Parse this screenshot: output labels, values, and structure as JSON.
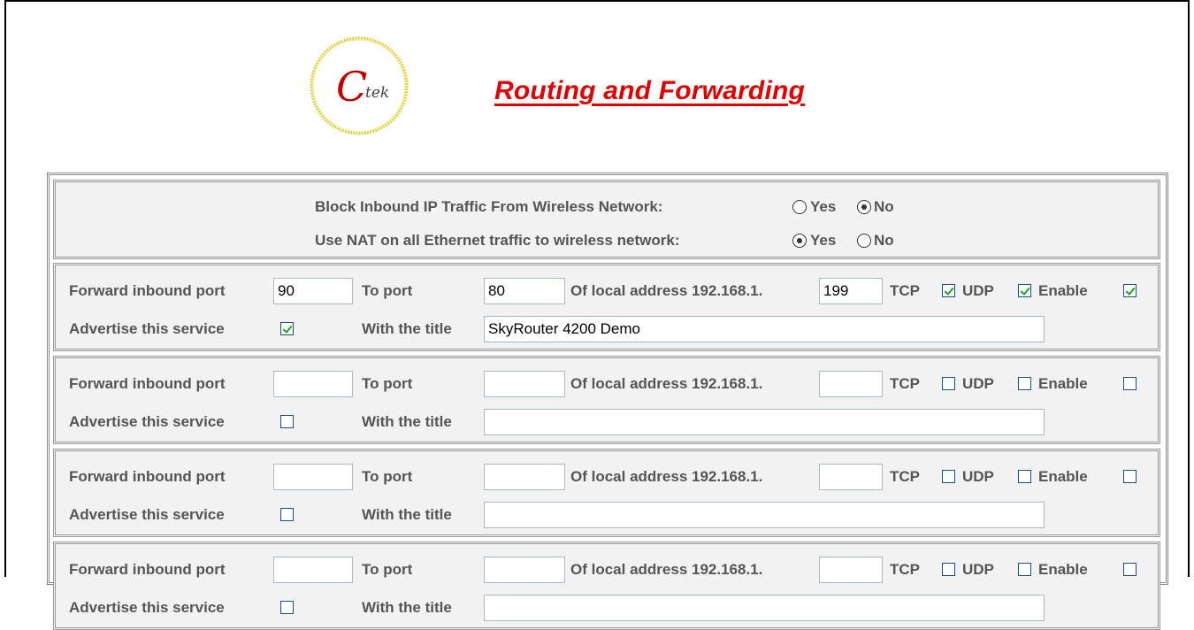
{
  "header": {
    "logo_text": "Ctek",
    "title": "Routing and Forwarding"
  },
  "general": {
    "block_inbound_label": "Block Inbound IP Traffic From Wireless Network:",
    "block_inbound_value": "No",
    "use_nat_label": "Use NAT on all Ethernet traffic to wireless network:",
    "use_nat_value": "Yes",
    "yes_label": "Yes",
    "no_label": "No"
  },
  "labels": {
    "forward_inbound_port": "Forward inbound port",
    "to_port": "To port",
    "of_local_address": "Of local address 192.168.1.",
    "tcp": "TCP",
    "udp": "UDP",
    "enable": "Enable",
    "advertise_service": "Advertise this service",
    "with_title": "With the title"
  },
  "rules": [
    {
      "inbound_port": "90",
      "to_port": "80",
      "local_address": "199",
      "tcp": true,
      "udp": true,
      "enable": true,
      "advertise": true,
      "title": "SkyRouter 4200 Demo"
    },
    {
      "inbound_port": "",
      "to_port": "",
      "local_address": "",
      "tcp": false,
      "udp": false,
      "enable": false,
      "advertise": false,
      "title": ""
    },
    {
      "inbound_port": "",
      "to_port": "",
      "local_address": "",
      "tcp": false,
      "udp": false,
      "enable": false,
      "advertise": false,
      "title": ""
    },
    {
      "inbound_port": "",
      "to_port": "",
      "local_address": "",
      "tcp": false,
      "udp": false,
      "enable": false,
      "advertise": false,
      "title": ""
    }
  ]
}
